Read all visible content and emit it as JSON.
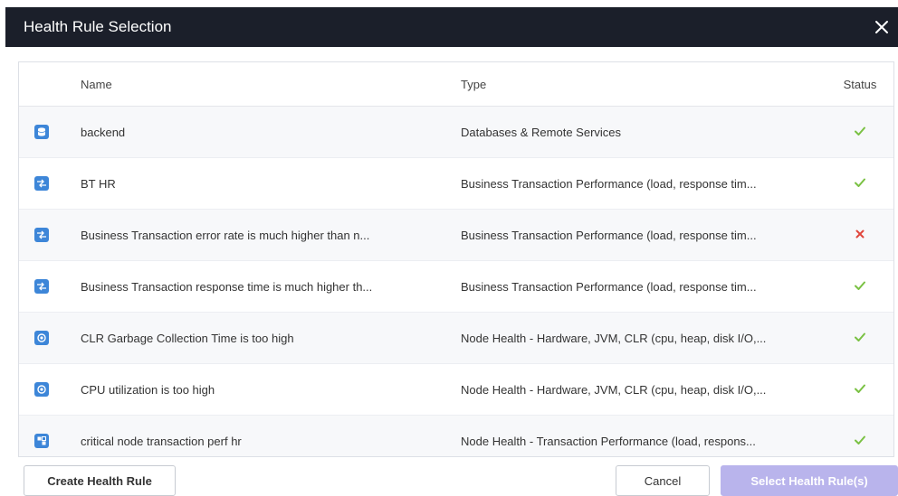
{
  "dialog": {
    "title": "Health Rule Selection",
    "close_icon": "close-icon"
  },
  "table": {
    "columns": {
      "name": "Name",
      "type": "Type",
      "status": "Status"
    },
    "rows": [
      {
        "icon": "database-icon",
        "name": "backend",
        "type": "Databases & Remote Services",
        "status": "ok"
      },
      {
        "icon": "business-transaction-icon",
        "name": "BT HR",
        "type": "Business Transaction Performance (load, response tim...",
        "status": "ok"
      },
      {
        "icon": "business-transaction-icon",
        "name": "Business Transaction error rate is much higher than n...",
        "type": "Business Transaction Performance (load, response tim...",
        "status": "error"
      },
      {
        "icon": "business-transaction-icon",
        "name": "Business Transaction response time is much higher th...",
        "type": "Business Transaction Performance (load, response tim...",
        "status": "ok"
      },
      {
        "icon": "node-health-icon",
        "name": "CLR Garbage Collection Time is too high",
        "type": "Node Health - Hardware, JVM, CLR (cpu, heap, disk I/O,...",
        "status": "ok"
      },
      {
        "icon": "node-health-icon",
        "name": "CPU utilization is too high",
        "type": "Node Health - Hardware, JVM, CLR (cpu, heap, disk I/O,...",
        "status": "ok"
      },
      {
        "icon": "node-transaction-icon",
        "name": "critical node transaction perf hr",
        "type": "Node Health - Transaction Performance (load, respons...",
        "status": "ok"
      }
    ]
  },
  "buttons": {
    "create": "Create Health Rule",
    "cancel": "Cancel",
    "select": "Select Health Rule(s)"
  },
  "colors": {
    "titlebar": "#1b1f2a",
    "icon_blue": "#3d86d8",
    "status_ok": "#7ac143",
    "status_error": "#e0463c",
    "select_button": "#b9b4ec"
  }
}
